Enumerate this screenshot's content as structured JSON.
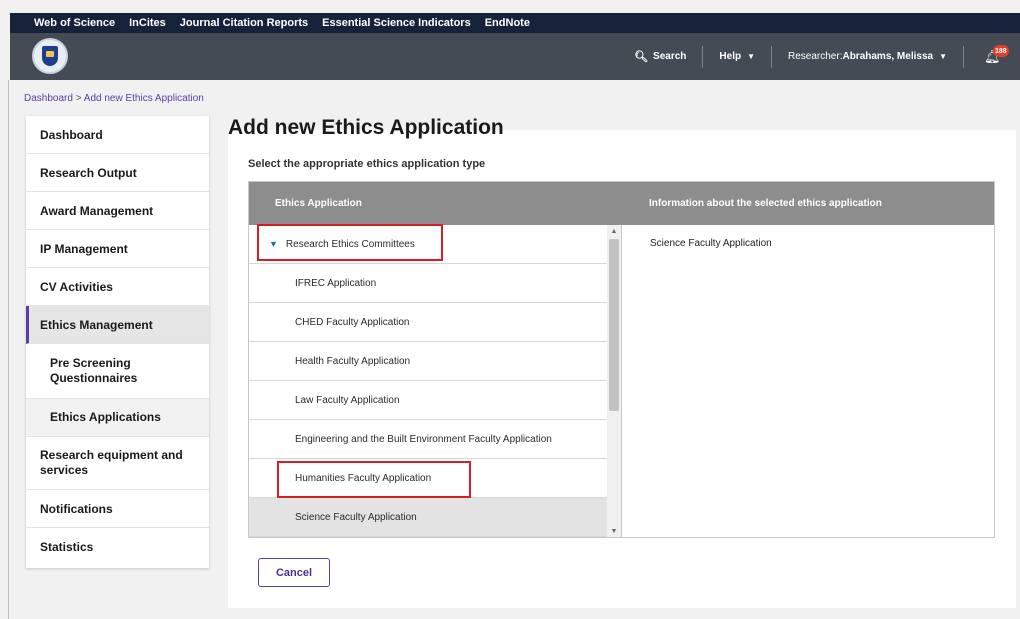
{
  "topbar": {
    "links": [
      "Web of Science",
      "InCites",
      "Journal Citation Reports",
      "Essential Science Indicators",
      "EndNote"
    ]
  },
  "header": {
    "search_label": "Search",
    "help_label": "Help",
    "researcher_prefix": "Researcher: ",
    "researcher_name": "Abrahams, Melissa",
    "notification_count": "188"
  },
  "breadcrumb": {
    "home": "Dashboard",
    "separator": " > ",
    "current": "Add new Ethics Application"
  },
  "sidebar": {
    "items": [
      {
        "label": "Dashboard"
      },
      {
        "label": "Research Output"
      },
      {
        "label": "Award Management"
      },
      {
        "label": "IP Management"
      },
      {
        "label": "CV Activities"
      },
      {
        "label": "Ethics Management"
      },
      {
        "label": "Pre Screening Questionnaires"
      },
      {
        "label": "Ethics Applications"
      },
      {
        "label": "Research equipment and services"
      },
      {
        "label": "Notifications"
      },
      {
        "label": "Statistics"
      }
    ]
  },
  "main": {
    "title": "Add new Ethics Application",
    "subtitle": "Select the appropriate ethics application type",
    "columns": [
      "Ethics Application",
      "Information about the selected ethics application"
    ],
    "group_label": "Research Ethics Committees",
    "applications": [
      "IFREC Application",
      "CHED Faculty Application",
      "Health Faculty Application",
      "Law Faculty Application",
      "Engineering and the Built Environment Faculty Application",
      "Humanities Faculty Application",
      "Science Faculty Application"
    ],
    "selected_info": "Science Faculty Application",
    "cancel_label": "Cancel"
  },
  "colors": {
    "topbar": "#16213a",
    "header": "#444b54",
    "accent": "#5b3fa8",
    "highlight": "#d32027",
    "table_header": "#8d8d8d"
  },
  "icons": [
    "search-icon",
    "chevron-down-icon",
    "bell-icon",
    "triangle-down-icon",
    "scroll-up-icon",
    "scroll-down-icon"
  ]
}
